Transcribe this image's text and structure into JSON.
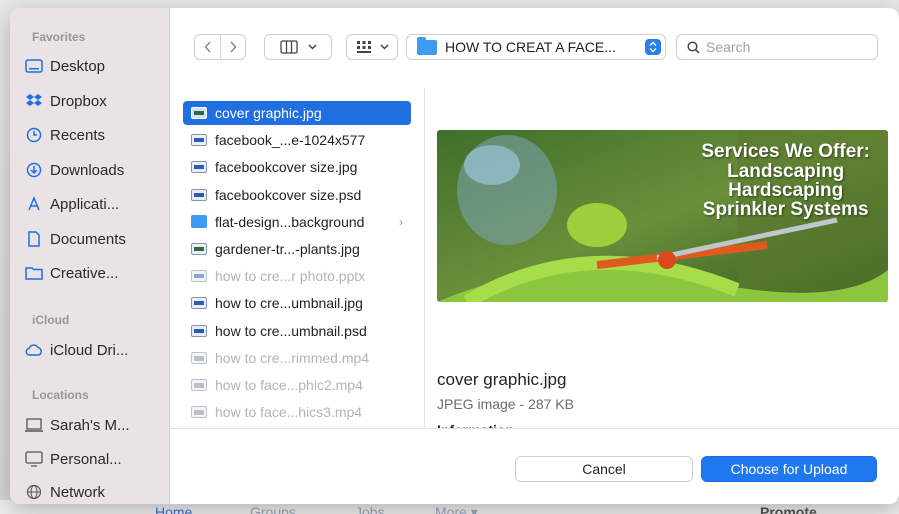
{
  "background": {
    "nav_items": [
      "Home",
      "Groups",
      "Jobs",
      "More ▾"
    ],
    "promote_label": "Promote"
  },
  "sidebar": {
    "favorites_title": "Favorites",
    "favorites": [
      {
        "label": "Desktop",
        "icon": "desktop-icon"
      },
      {
        "label": "Dropbox",
        "icon": "dropbox-icon"
      },
      {
        "label": "Recents",
        "icon": "clock-icon"
      },
      {
        "label": "Downloads",
        "icon": "download-icon"
      },
      {
        "label": "Applicati...",
        "icon": "applications-icon"
      },
      {
        "label": "Documents",
        "icon": "document-icon"
      },
      {
        "label": "Creative...",
        "icon": "folder-icon"
      }
    ],
    "icloud_title": "iCloud",
    "icloud": [
      {
        "label": "iCloud Dri...",
        "icon": "cloud-icon"
      }
    ],
    "locations_title": "Locations",
    "locations": [
      {
        "label": "Sarah's M...",
        "icon": "laptop-icon"
      },
      {
        "label": "Personal...",
        "icon": "display-icon"
      },
      {
        "label": "Network",
        "icon": "network-icon"
      }
    ]
  },
  "toolbar": {
    "path_label": "HOW TO CREAT A FACE...",
    "search_placeholder": "Search"
  },
  "files": [
    {
      "name": "cover graphic.jpg",
      "kind": "img",
      "state": "selected"
    },
    {
      "name": "facebook_...e-1024x577",
      "kind": "doc",
      "state": "normal"
    },
    {
      "name": "facebookcover size.jpg",
      "kind": "doc",
      "state": "normal"
    },
    {
      "name": "facebookcover size.psd",
      "kind": "doc",
      "state": "normal"
    },
    {
      "name": "flat-design...background",
      "kind": "folder",
      "state": "normal"
    },
    {
      "name": "gardener-tr...-plants.jpg",
      "kind": "img",
      "state": "normal"
    },
    {
      "name": "how to cre...r photo.pptx",
      "kind": "doc",
      "state": "disabled"
    },
    {
      "name": "how to cre...umbnail.jpg",
      "kind": "doc",
      "state": "normal"
    },
    {
      "name": "how to cre...umbnail.psd",
      "kind": "doc",
      "state": "normal"
    },
    {
      "name": "how to cre...rimmed.mp4",
      "kind": "vid",
      "state": "disabled"
    },
    {
      "name": "how to face...phic2.mp4",
      "kind": "vid",
      "state": "disabled"
    },
    {
      "name": "how to face...hics3.mp4",
      "kind": "vid",
      "state": "disabled"
    }
  ],
  "preview": {
    "image_lines": [
      "Services We Offer:",
      "Landscaping",
      "Hardscaping",
      "Sprinkler Systems"
    ],
    "filename": "cover graphic.jpg",
    "meta": "JPEG image - 287 KB",
    "info": "Information"
  },
  "buttons": {
    "cancel": "Cancel",
    "primary": "Choose for Upload"
  },
  "colors": {
    "accent": "#1f78f0",
    "sidebar_bg": "#e9e3e6",
    "selection": "#1f6fe0"
  }
}
